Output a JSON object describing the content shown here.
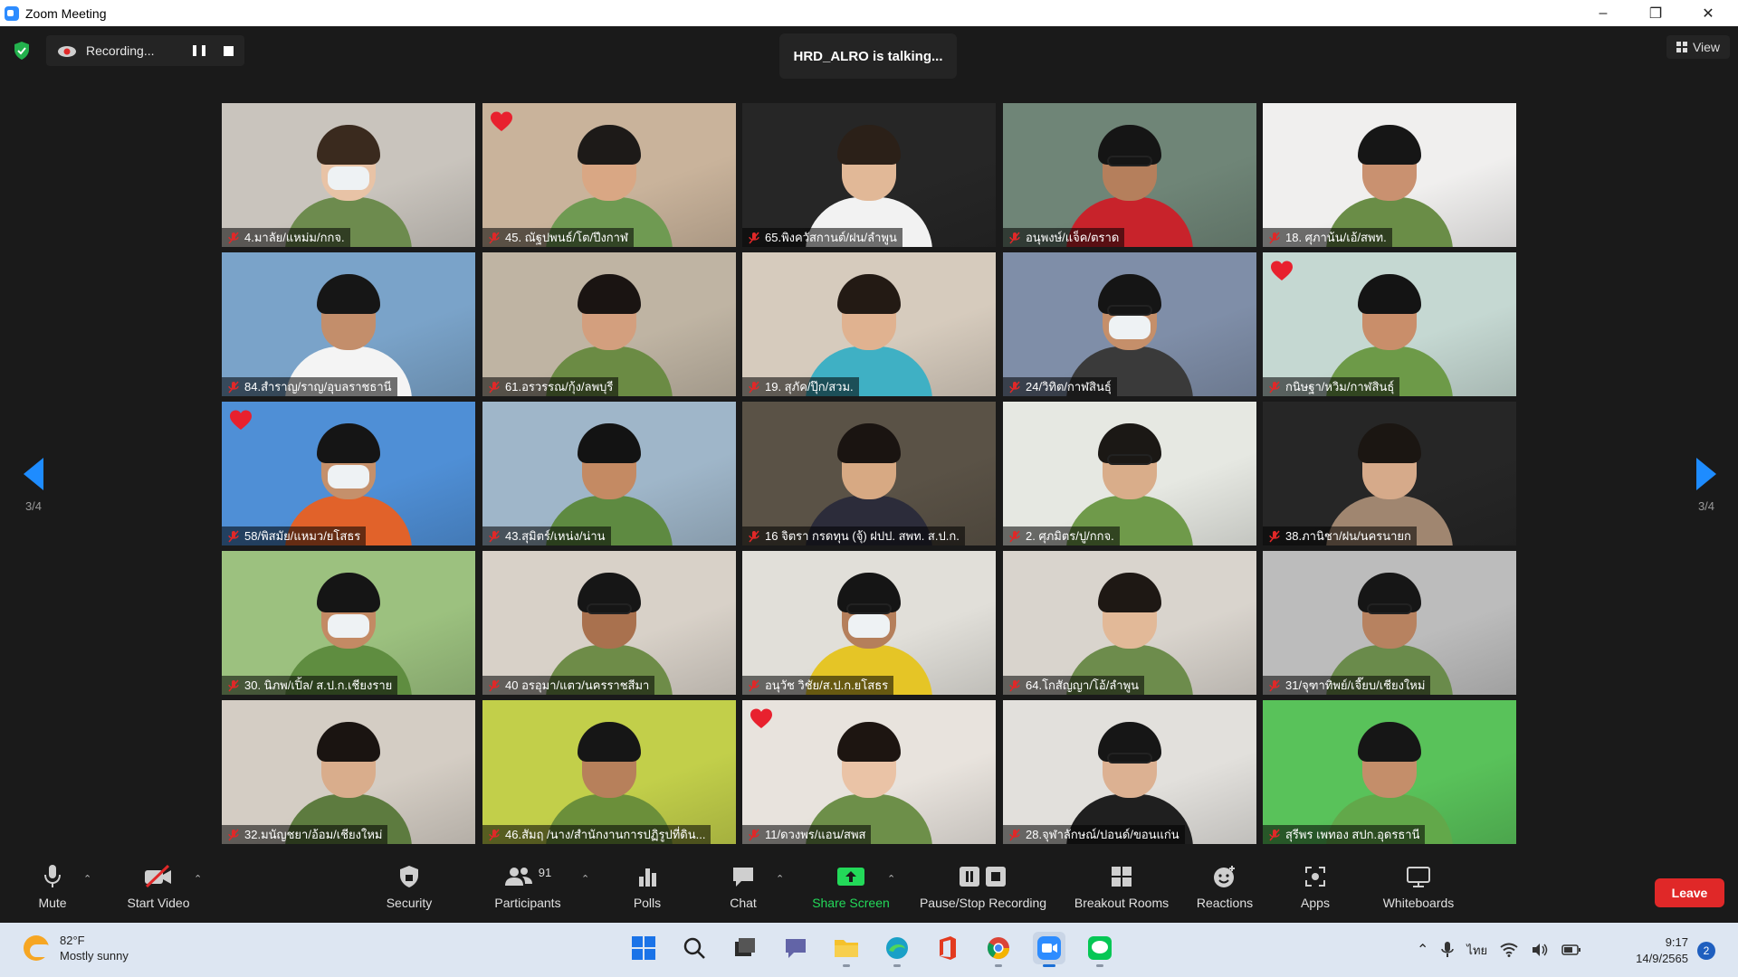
{
  "window": {
    "title": "Zoom Meeting"
  },
  "recording": {
    "label": "Recording..."
  },
  "talking": "HRD_ALRO is talking...",
  "view_button": "View",
  "pagination": {
    "left": "3/4",
    "right": "3/4"
  },
  "colors": {
    "accent": "#1e8cff",
    "leave": "#e02828",
    "share_screen": "#23d959"
  },
  "tiles": [
    {
      "name": "4.มาลัย/แหม่ม/กกจ.",
      "heart": false,
      "bg": "#c9c4bd",
      "shirt": "#6d8b4e",
      "skin": "#e8c3a6",
      "hair": "#3a2a1e",
      "mask": true,
      "glasses": false
    },
    {
      "name": "45. ณัฐปพนธ์/โต/ปึงกาฬ",
      "heart": true,
      "bg": "#c9b39b",
      "shirt": "#6f9a52",
      "skin": "#d9a784",
      "hair": "#1d1a18",
      "mask": false,
      "glasses": false
    },
    {
      "name": "65.พิงควัสกานต์/ฝน/ลำพูน",
      "heart": false,
      "bg": "#262626",
      "shirt": "#f2f2f2",
      "skin": "#e1b897",
      "hair": "#2b2018",
      "mask": false,
      "glasses": false
    },
    {
      "name": "อนุพงษ์/แจ็ค/ตราด",
      "heart": false,
      "bg": "#6f8577",
      "shirt": "#c8232b",
      "skin": "#b57f5c",
      "hair": "#151515",
      "mask": false,
      "glasses": true
    },
    {
      "name": "18. ศุภาน้น/เอ้/สพท.",
      "heart": false,
      "bg": "#f0efee",
      "shirt": "#6a8d47",
      "skin": "#c99170",
      "hair": "#161616",
      "mask": false,
      "glasses": false
    },
    {
      "name": "84.สำราญ/ราญ/อุบลราชธานี",
      "heart": false,
      "bg": "#7aa3c9",
      "shirt": "#f4f4f4",
      "skin": "#c38e6b",
      "hair": "#161616",
      "mask": false,
      "glasses": false
    },
    {
      "name": "61.อรวรรณ/กุ้ง/ลพบุรี",
      "heart": false,
      "bg": "#bfb4a3",
      "shirt": "#6b8b44",
      "skin": "#d39f7e",
      "hair": "#1a1412",
      "mask": false,
      "glasses": false
    },
    {
      "name": "19. สุภัค/ปุ๊ก/สวม.",
      "heart": false,
      "bg": "#d6cbbd",
      "shirt": "#3fb0c4",
      "skin": "#e0b290",
      "hair": "#231a14",
      "mask": false,
      "glasses": false
    },
    {
      "name": "24/วิทิต/กาฬสินธุ์",
      "heart": false,
      "bg": "#7f8ea8",
      "shirt": "#3a3a3a",
      "skin": "#c58f6a",
      "hair": "#151515",
      "mask": true,
      "glasses": true
    },
    {
      "name": "กนิษฐา/หวิม/กาฬสินธุ์",
      "heart": true,
      "bg": "#c5d8d2",
      "shirt": "#6d9a48",
      "skin": "#c98e6a",
      "hair": "#141414",
      "mask": false,
      "glasses": false
    },
    {
      "name": "58/พิสมัย/แหมว/ยโสธร",
      "heart": true,
      "bg": "#4f8fd6",
      "shirt": "#e1622a",
      "skin": "#c5906b",
      "hair": "#151515",
      "mask": true,
      "glasses": false
    },
    {
      "name": "43.สุมิตร์/เหน่ง/น่าน",
      "heart": false,
      "bg": "#9fb6c9",
      "shirt": "#5e8a41",
      "skin": "#c48a63",
      "hair": "#131313",
      "mask": false,
      "glasses": false
    },
    {
      "name": "16 จิตรา กรดทุน (จุ้) ฝปป. สพท. ส.ป.ก.",
      "heart": false,
      "bg": "#5a5246",
      "shirt": "#2c2c3a",
      "skin": "#d7a983",
      "hair": "#1a1411",
      "mask": false,
      "glasses": false
    },
    {
      "name": "2. ศุภมิตร/ปู/กกจ.",
      "heart": false,
      "bg": "#e6e8e2",
      "shirt": "#6f9a4a",
      "skin": "#d9ad8a",
      "hair": "#1b1815",
      "mask": false,
      "glasses": true
    },
    {
      "name": "38.ภานิชา/ฝน/นครนายก",
      "heart": false,
      "bg": "#262626",
      "shirt": "#a08670",
      "skin": "#d6aa8a",
      "hair": "#1b1612",
      "mask": false,
      "glasses": false
    },
    {
      "name": "30. นิภพ/เปิ้ล/ ส.ป.ก.เชียงราย",
      "heart": false,
      "bg": "#9cc17f",
      "shirt": "#5f8d40",
      "skin": "#c38a64",
      "hair": "#151515",
      "mask": true,
      "glasses": false
    },
    {
      "name": "40 อรอุมา/แตว/นครราชสีมา",
      "heart": false,
      "bg": "#d8d1c8",
      "shirt": "#6e8c48",
      "skin": "#a9714e",
      "hair": "#161616",
      "mask": false,
      "glasses": true
    },
    {
      "name": "อนุวัช วิชัย/ส.ป.ก.ยโสธร",
      "heart": false,
      "bg": "#e1dfd9",
      "shirt": "#e5c526",
      "skin": "#b57f5b",
      "hair": "#151515",
      "mask": true,
      "glasses": true
    },
    {
      "name": "64.โกสัญญา/โอ้/ลำพูน",
      "heart": false,
      "bg": "#d9d4cd",
      "shirt": "#6d8c4c",
      "skin": "#e2b998",
      "hair": "#1e1814",
      "mask": false,
      "glasses": false
    },
    {
      "name": "31/จุฑาทิพย์/เจี๊ยบ/เชียงใหม่",
      "heart": false,
      "bg": "#bcbcbc",
      "shirt": "#6a8b4b",
      "skin": "#b78260",
      "hair": "#161616",
      "mask": false,
      "glasses": true
    },
    {
      "name": "32.มนัญชยา/อ้อม/เชียงใหม่",
      "heart": false,
      "bg": "#d4cdc4",
      "shirt": "#5d7b3f",
      "skin": "#d9ad8c",
      "hair": "#1a1411",
      "mask": false,
      "glasses": false
    },
    {
      "name": "46.สัมฤ /นาง/สำนักงานการปฏิรูปที่ดิน...",
      "heart": false,
      "bg": "#c2cf4a",
      "shirt": "#6b8f3a",
      "skin": "#b7805b",
      "hair": "#161616",
      "mask": false,
      "glasses": false
    },
    {
      "name": "11/ดวงพร/แอน/สพส",
      "heart": true,
      "bg": "#e8e3dd",
      "shirt": "#6d8f49",
      "skin": "#eac3a6",
      "hair": "#1d1511",
      "mask": false,
      "glasses": false
    },
    {
      "name": "28.จุฬาลักษณ์/ปอนด์/ขอนแก่น",
      "heart": false,
      "bg": "#e2e0dc",
      "shirt": "#1f1f1f",
      "skin": "#dcb192",
      "hair": "#161616",
      "mask": false,
      "glasses": true
    },
    {
      "name": "สุรีพร  เพทอง สปก.อุดรธานี",
      "heart": false,
      "bg": "#59c25a",
      "shirt": "#62a84a",
      "skin": "#c48e6a",
      "hair": "#161616",
      "mask": false,
      "glasses": false
    }
  ],
  "toolbar": {
    "mute": "Mute",
    "start_video": "Start Video",
    "security": "Security",
    "participants": "Participants",
    "participants_count": "91",
    "polls": "Polls",
    "chat": "Chat",
    "share_screen": "Share Screen",
    "pause_stop": "Pause/Stop Recording",
    "breakout": "Breakout Rooms",
    "reactions": "Reactions",
    "apps": "Apps",
    "whiteboards": "Whiteboards",
    "leave": "Leave"
  },
  "taskbar": {
    "temp": "82°F",
    "weather": "Mostly sunny",
    "lang": "ไทย",
    "time": "9:17",
    "date": "14/9/2565",
    "notifications": "2"
  }
}
